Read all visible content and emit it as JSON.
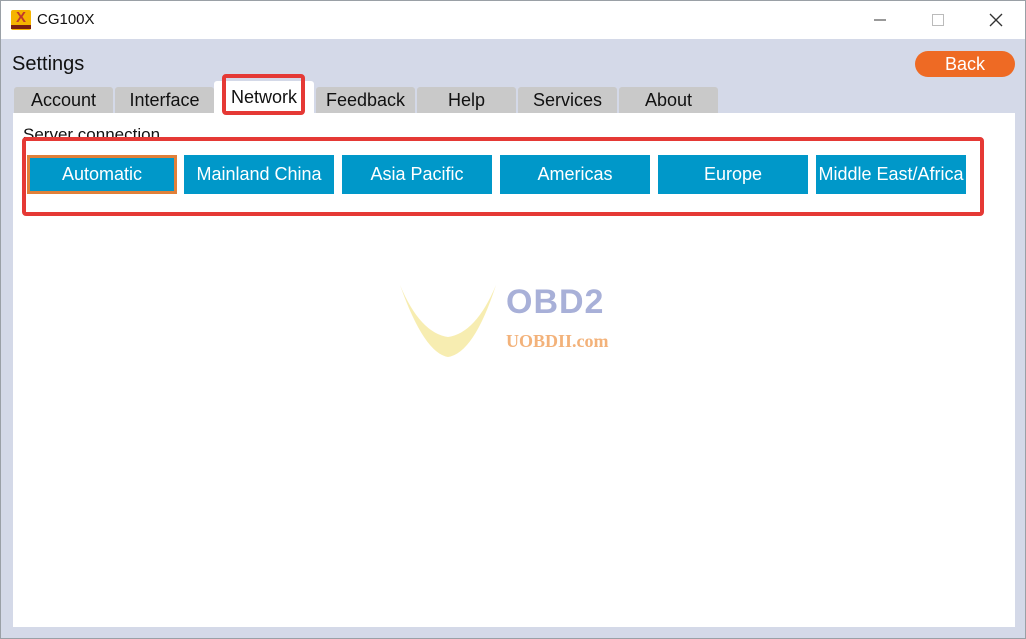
{
  "window": {
    "title": "CG100X",
    "controls": {
      "minimize": "minimize-icon",
      "maximize": "maximize-icon",
      "close": "close-icon"
    }
  },
  "header": {
    "title": "Settings",
    "back_label": "Back"
  },
  "tabs": [
    {
      "label": "Account",
      "active": false
    },
    {
      "label": "Interface",
      "active": false
    },
    {
      "label": "Network",
      "active": true
    },
    {
      "label": "Feedback",
      "active": false
    },
    {
      "label": "Help",
      "active": false
    },
    {
      "label": "Services",
      "active": false
    },
    {
      "label": "About",
      "active": false
    }
  ],
  "network": {
    "section_label": "Server connection",
    "servers": [
      {
        "label": "Automatic",
        "selected": true
      },
      {
        "label": "Mainland China",
        "selected": false
      },
      {
        "label": "Asia Pacific",
        "selected": false
      },
      {
        "label": "Americas",
        "selected": false
      },
      {
        "label": "Europe",
        "selected": false
      },
      {
        "label": "Middle East/Africa",
        "selected": false
      }
    ]
  },
  "watermark": {
    "brand": "OBD2",
    "site": "UOBDII.com"
  },
  "colors": {
    "accent_orange": "#ee6a24",
    "server_button": "#0098c9",
    "highlight_red": "#e53935",
    "background": "#d4d9e8"
  }
}
